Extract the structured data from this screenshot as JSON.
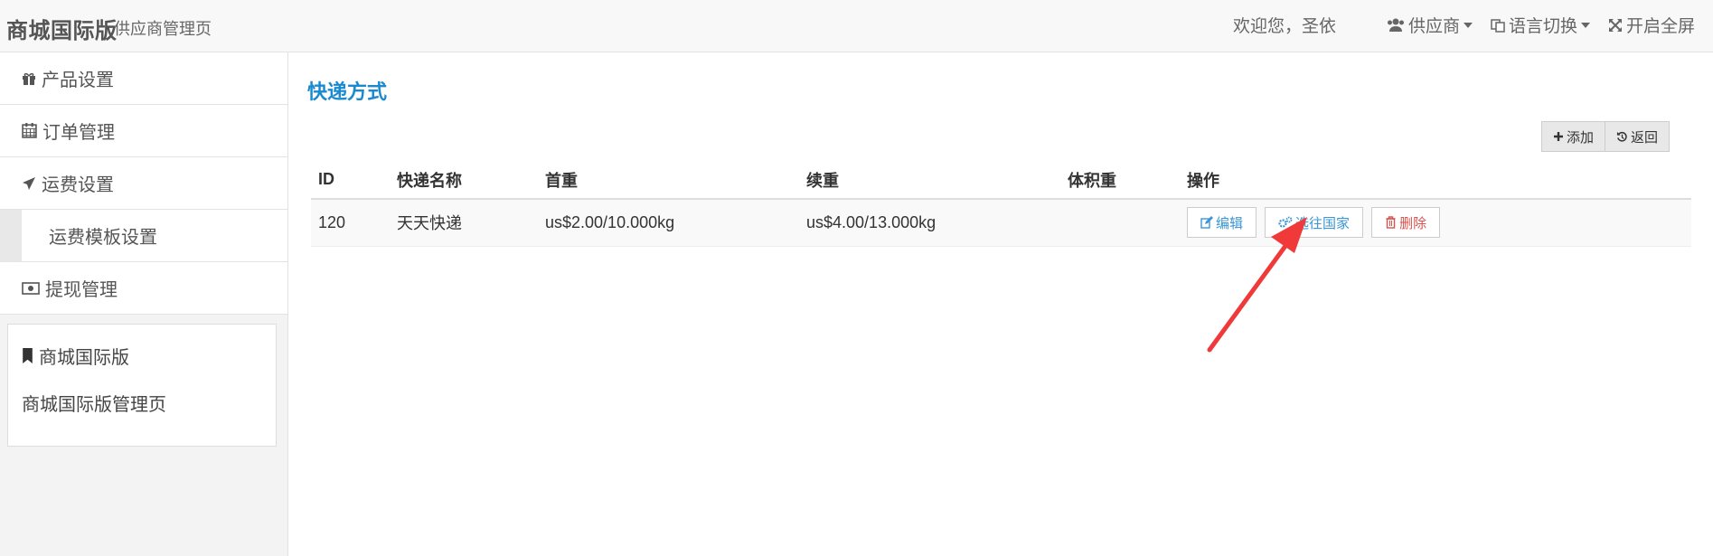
{
  "header": {
    "brand": "商城国际版",
    "brand_sub": "供应商管理页",
    "welcome": "欢迎您，圣依",
    "nav": [
      {
        "label": "供应商",
        "icon": "users-icon"
      },
      {
        "label": "语言切换",
        "icon": "language-icon"
      },
      {
        "label": "开启全屏",
        "icon": "fullscreen-icon"
      }
    ]
  },
  "sidebar": {
    "items": [
      {
        "label": "产品设置",
        "icon": "gift-icon"
      },
      {
        "label": "订单管理",
        "icon": "calendar-icon"
      },
      {
        "label": "运费设置",
        "icon": "plane-icon"
      },
      {
        "label": "运费模板设置",
        "sub": true
      },
      {
        "label": "提现管理",
        "icon": "money-icon"
      }
    ],
    "info": {
      "title": "商城国际版",
      "text": "商城国际版管理页"
    }
  },
  "main": {
    "title": "快递方式",
    "buttons": {
      "add": "添加",
      "back": "返回"
    },
    "table": {
      "columns": [
        "ID",
        "快递名称",
        "首重",
        "续重",
        "体积重",
        "操作"
      ],
      "rows": [
        {
          "id": "120",
          "name": "天天快递",
          "first": "us$2.00/10.000kg",
          "next": "us$4.00/13.000kg",
          "volume": ""
        }
      ],
      "actions": {
        "edit": "编辑",
        "country": "选往国家",
        "delete": "删除"
      }
    }
  },
  "colors": {
    "accent": "#1a8ad0",
    "danger": "#d9534f",
    "annotation": "#f03a3a"
  }
}
